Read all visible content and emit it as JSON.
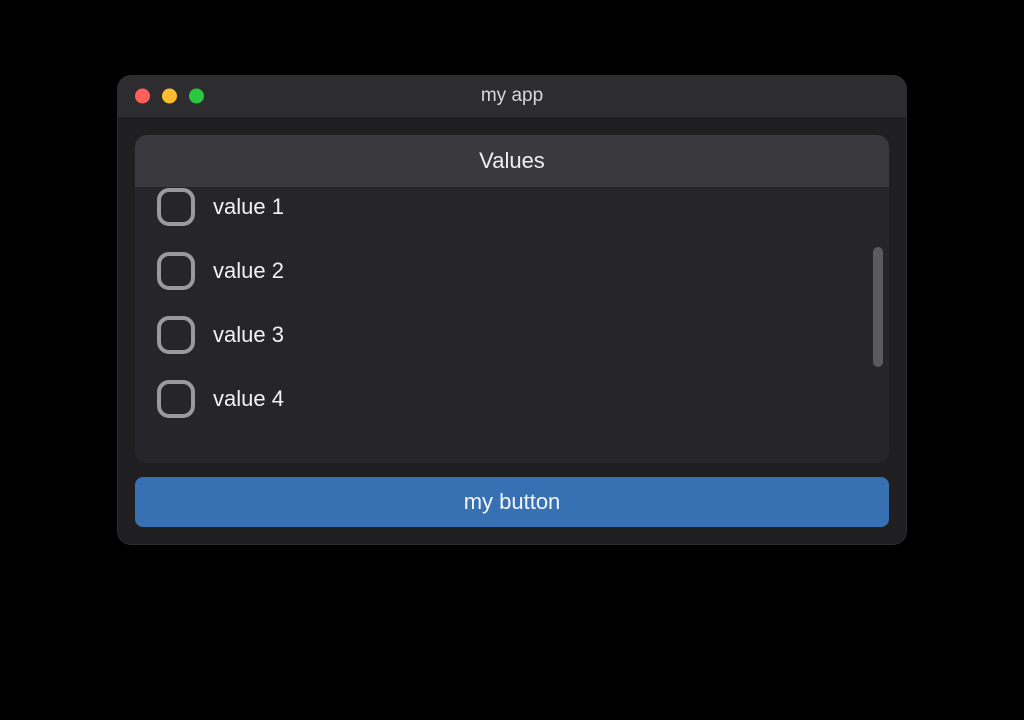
{
  "window": {
    "title": "my app"
  },
  "list": {
    "header": "Values",
    "items": [
      {
        "label": "value 1",
        "checked": false
      },
      {
        "label": "value 2",
        "checked": false
      },
      {
        "label": "value 3",
        "checked": false
      },
      {
        "label": "value 4",
        "checked": false
      }
    ]
  },
  "actions": {
    "primary_label": "my button"
  },
  "colors": {
    "accent": "#3770b3",
    "surface": "#26262a",
    "chrome": "#2d2d30"
  }
}
